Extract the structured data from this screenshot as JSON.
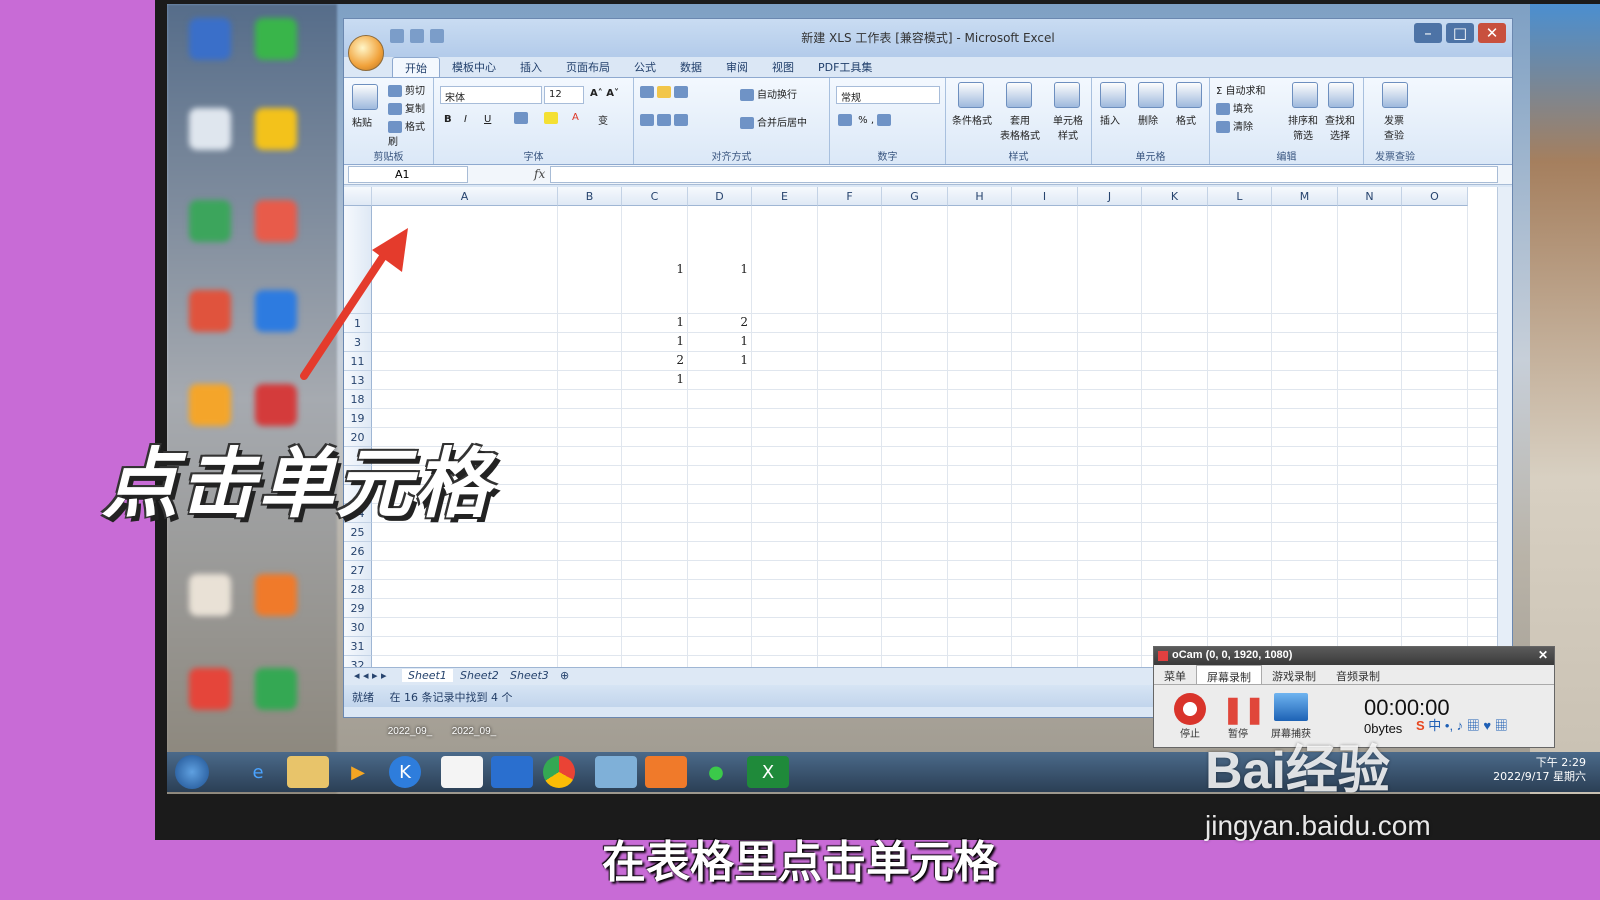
{
  "excel": {
    "title": "新建 XLS 工作表 [兼容模式] - Microsoft Excel",
    "tabs": [
      "开始",
      "模板中心",
      "插入",
      "页面布局",
      "公式",
      "数据",
      "审阅",
      "视图",
      "PDF工具集"
    ],
    "clipboard": {
      "paste": "粘贴",
      "cut": "剪切",
      "copy": "复制",
      "format_painter": "格式刷",
      "label": "剪贴板"
    },
    "font": {
      "name": "宋体",
      "size": "12",
      "label": "字体"
    },
    "alignment": {
      "wrap": "自动换行",
      "merge": "合并后居中",
      "label": "对齐方式"
    },
    "number": {
      "format": "常规",
      "label": "数字"
    },
    "styles": {
      "conditional": "条件格式",
      "table_format": "套用\n表格格式",
      "cell_style": "单元格\n样式",
      "label": "样式"
    },
    "cells": {
      "insert": "插入",
      "delete": "删除",
      "format": "格式",
      "label": "单元格"
    },
    "editing": {
      "autosum": "自动求和",
      "fill": "填充",
      "clear": "清除",
      "sort": "排序和\n筛选",
      "find": "查找和\n选择",
      "label": "编辑"
    },
    "invoice": {
      "check": "发票\n查验",
      "label": "发票查验"
    },
    "name_box": "A1",
    "fx": "fx",
    "columns": [
      "A",
      "B",
      "C",
      "D",
      "E",
      "F",
      "G",
      "H",
      "I",
      "J",
      "K",
      "L",
      "M",
      "N",
      "O"
    ],
    "rows": [
      "",
      "1",
      "3",
      "11",
      "13",
      "18",
      "19",
      "20",
      "",
      "",
      "",
      "24",
      "25",
      "26",
      "27",
      "28",
      "29",
      "30",
      "31",
      "32"
    ],
    "cells_data": [
      {
        "row": 0,
        "c": "1",
        "d": "1"
      },
      {
        "row": 1,
        "c": "1",
        "d": "2"
      },
      {
        "row": 2,
        "c": "1",
        "d": "1"
      },
      {
        "row": 3,
        "c": "2",
        "d": "1"
      },
      {
        "row": 4,
        "c": "1",
        "d": ""
      }
    ],
    "sheets": [
      "Sheet1",
      "Sheet2",
      "Sheet3"
    ],
    "status": "就绪",
    "status_detail": "在 16 条记录中找到 4 个"
  },
  "ocam": {
    "title": "oCam (0, 0, 1920, 1080)",
    "tabs": [
      "菜单",
      "屏幕录制",
      "游戏录制",
      "音频录制"
    ],
    "stop": "停止",
    "pause": "暂停",
    "capture": "屏幕捕获",
    "time": "00:00:00",
    "bytes": "0bytes"
  },
  "desktop_labels": [
    "2022_09_",
    "2022_09_"
  ],
  "taskbar": {
    "time": "下午 2:29",
    "date": "2022/9/17 星期六"
  },
  "captions": {
    "big": "点击单元格",
    "sub": "在表格里点击单元格"
  },
  "watermark": {
    "brand": "Bai经验",
    "url": "jingyan.baidu.com"
  },
  "colors": {
    "background": "#c86bd6",
    "excel_blue": "#dbe7f5",
    "arrow": "#e43b2c"
  }
}
